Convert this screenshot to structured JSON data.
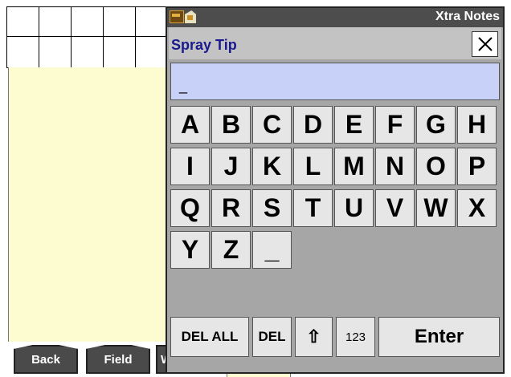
{
  "background": {
    "buttons": {
      "back": "Back",
      "field": "Field",
      "third": "W"
    }
  },
  "dialog": {
    "titlebar": {
      "title": "Xtra Notes",
      "icons": [
        "implement-icon",
        "notes-icon"
      ]
    },
    "header": {
      "title": "Spray Tip",
      "close_label": "×"
    },
    "input": {
      "value": "_"
    },
    "keyboard": {
      "rows": [
        [
          "A",
          "B",
          "C",
          "D",
          "E",
          "F",
          "G",
          "H"
        ],
        [
          "I",
          "J",
          "K",
          "L",
          "M",
          "N",
          "O",
          "P"
        ],
        [
          "Q",
          "R",
          "S",
          "T",
          "U",
          "V",
          "W",
          "X"
        ],
        [
          "Y",
          "Z",
          "_"
        ]
      ]
    },
    "function_keys": {
      "del_all": "DEL ALL",
      "del": "DEL",
      "shift": "⇧",
      "numbers": "123",
      "enter": "Enter"
    }
  },
  "colors": {
    "dialog_bg": "#a6a6a6",
    "titlebar_bg": "#4d4d4d",
    "header_title": "#1a1a8e",
    "input_bg": "#c8d2f8",
    "key_bg": "#e6e6e6",
    "panel_bg": "#fdfbd0"
  }
}
